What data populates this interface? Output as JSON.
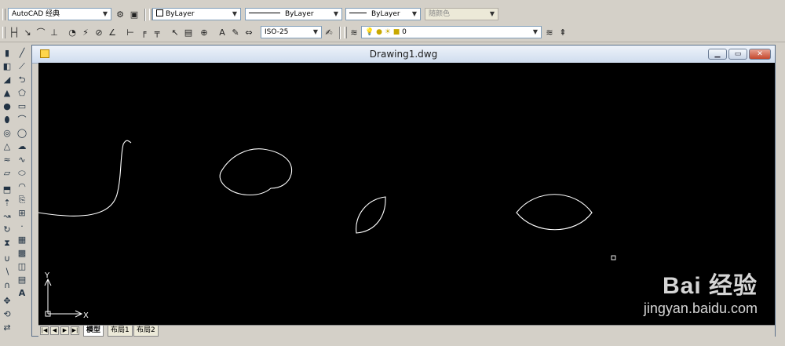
{
  "toolbar": {
    "workspace": "AutoCAD 经典",
    "layer_color": "ByLayer",
    "linetype": "ByLayer",
    "lineweight": "ByLayer",
    "plot_style": "随颜色",
    "dim_style": "ISO-25",
    "layer_name": "0"
  },
  "window": {
    "title": "Drawing1.dwg"
  },
  "canvas": {
    "ucs_x": "X",
    "ucs_y": "Y"
  },
  "tabs": [
    {
      "label": "模型",
      "active": true
    },
    {
      "label": "布局1",
      "active": false
    },
    {
      "label": "布局2",
      "active": false
    }
  ],
  "watermark": {
    "logo": "Bai  经验",
    "url": "jingyan.baidu.com"
  },
  "colors": {
    "canvas_bg": "#000000",
    "stroke": "#ffffff",
    "chrome": "#d4d0c8"
  }
}
